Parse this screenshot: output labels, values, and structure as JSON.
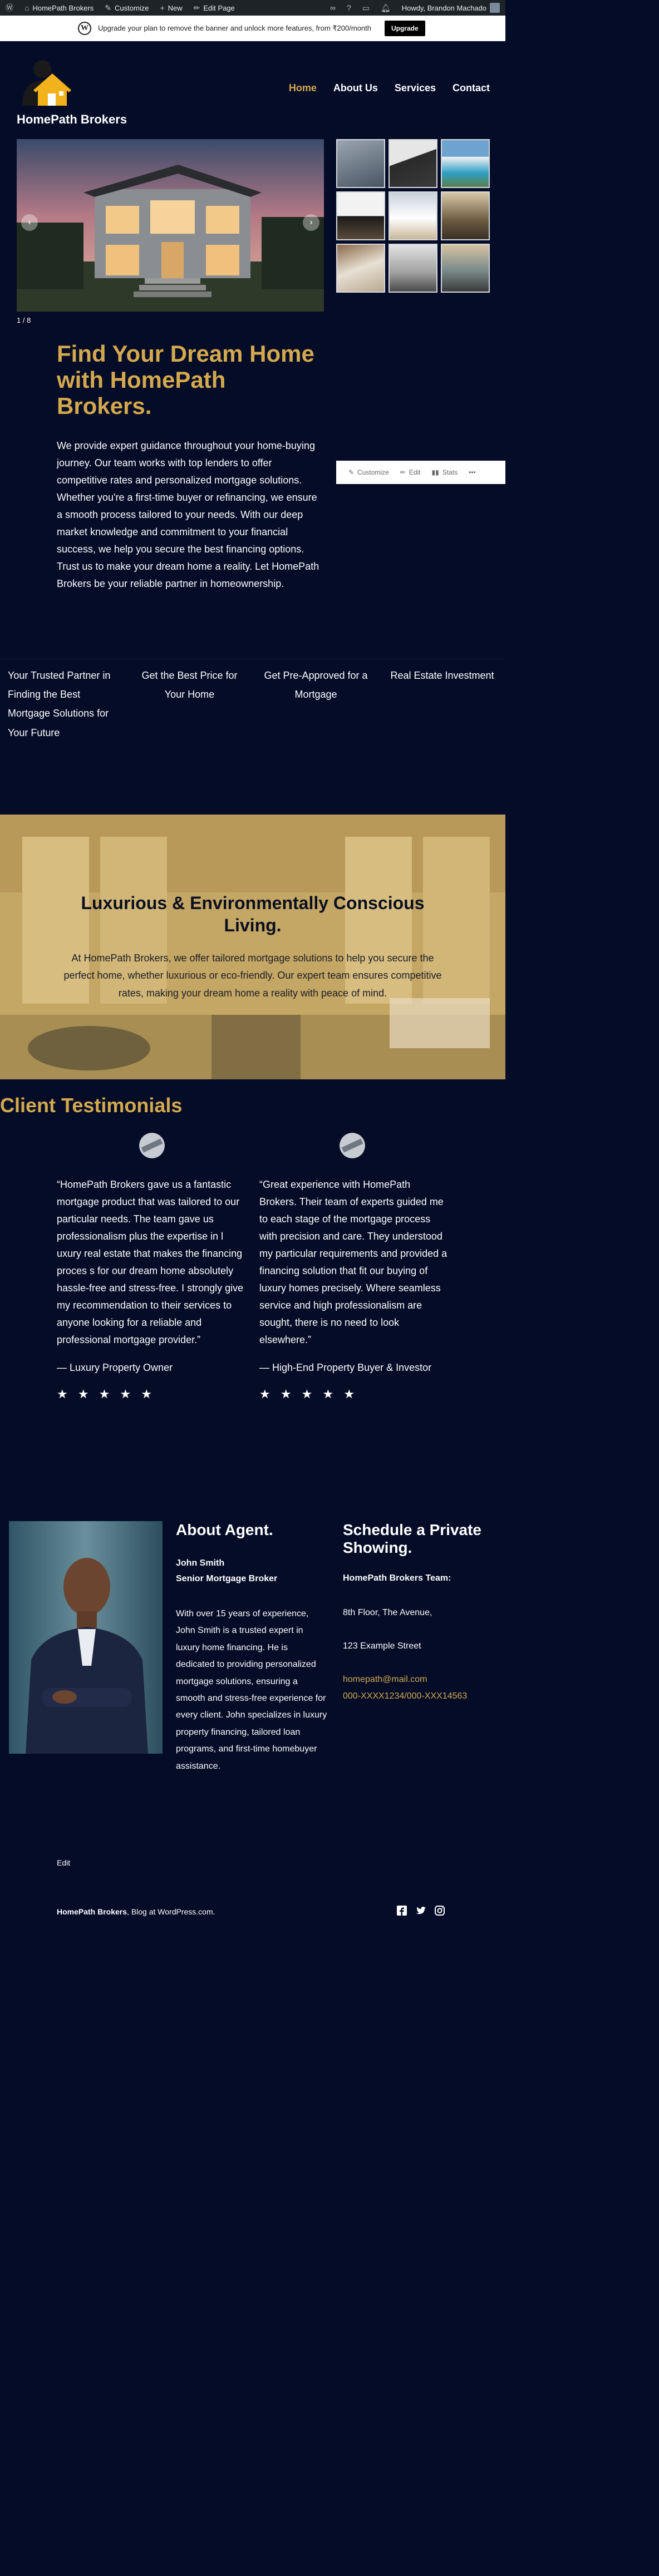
{
  "admin_bar": {
    "site_name": "HomePath Brokers",
    "customize": "Customize",
    "new": "New",
    "edit_page": "Edit Page",
    "greeting": "Howdy, Brandon Machado"
  },
  "banner": {
    "text": "Upgrade your plan to remove the banner and unlock more features, from ₹200/month",
    "button": "Upgrade"
  },
  "header": {
    "site_title": "HomePath Brokers",
    "nav": [
      "Home",
      "About Us",
      "Services",
      "Contact"
    ]
  },
  "slider": {
    "counter": "1 / 8",
    "prev": "‹",
    "next": "›"
  },
  "hero": {
    "title": "Find Your Dream Home with HomePath Brokers.",
    "text": "We provide expert guidance throughout your home-buying journey. Our team works with top lenders to offer competitive rates and personalized mortgage solutions. Whether you're a first-time buyer or refinancing, we ensure a smooth process tailored to your needs. With our deep market knowledge and commitment to your financial success, we help you secure the best financing options. Trust us to make your dream home a reality. Let HomePath Brokers be your reliable partner in homeownership."
  },
  "floating_toolbar": {
    "customize": "Customize",
    "edit": "Edit",
    "stats": "Stats",
    "more": "•••"
  },
  "features": [
    "Your Trusted Partner in Finding the Best Mortgage Solutions for Your Future",
    "Get the Best Price for Your Home",
    "Get Pre-Approved for a Mortgage",
    "Real Estate Investment"
  ],
  "cover": {
    "title": "Luxurious & Environmentally Conscious Living.",
    "text": "At HomePath Brokers, we offer tailored mortgage solutions to help you secure the perfect home, whether luxurious or eco-friendly. Our expert team ensures competitive rates, making your dream home a reality with peace of mind."
  },
  "testimonials": {
    "title": "Client Testimonials",
    "items": [
      {
        "quote": "“HomePath Brokers gave us a fantastic mortgage product that was tailored to our particular needs. The team gave us professionalism plus the expertise in l uxury real estate that makes the financing proces s for our dream home absolutely hassle-free and stress-free. I strongly give my recommendation to their services to anyone looking for a reliable and professional mortgage provider.”",
        "author": "— Luxury Property Owner",
        "stars": "★ ★ ★ ★ ★"
      },
      {
        "quote": "“Great experience with HomePath Brokers. Their team of experts guided me to each stage of the mortgage process with precision and care. They understood my particular requirements and provided a financing solution that fit our buying of luxury homes precisely. Where seamless service and high professionalism are sought, there is no need to look elsewhere.”",
        "author": "— High-End Property Buyer & Investor",
        "stars": "★ ★ ★ ★ ★"
      }
    ]
  },
  "about": {
    "title": "About Agent.",
    "name": "John Smith",
    "role": "Senior Mortgage Broker",
    "text": "With over 15 years of experience, John Smith is a trusted expert in luxury home financing. He is dedicated to providing personalized mortgage solutions, ensuring a smooth and stress-free experience for every client. John specializes in luxury property financing, tailored loan programs, and first-time homebuyer assistance."
  },
  "schedule": {
    "title": "Schedule a Private Showing.",
    "team": "HomePath Brokers Team:",
    "address1": "8th Floor, The Avenue,",
    "address2": "123 Example Street",
    "email": "homepath@mail.com",
    "phone": "000-XXXX1234/000-XXX14563"
  },
  "footer": {
    "edit": "Edit",
    "brand": "HomePath Brokers",
    "credit": ", Blog at WordPress.com."
  },
  "colors": {
    "background": "#040c27",
    "accent": "#d4a94e",
    "admin_bar": "#1d2327"
  },
  "icons": [
    "wordpress-icon",
    "customize-icon",
    "plus-icon",
    "pencil-icon",
    "infinity-icon",
    "help-icon",
    "bell-icon",
    "facebook-icon",
    "twitter-icon",
    "instagram-icon"
  ]
}
